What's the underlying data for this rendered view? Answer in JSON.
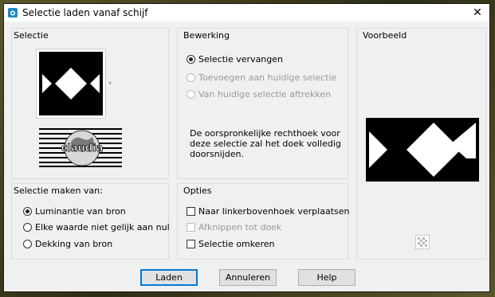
{
  "window": {
    "title": "Selectie laden vanaf schijf",
    "close_glyph": "✕"
  },
  "groups": {
    "selectie": {
      "label": "Selectie",
      "watermark_text": "claudia"
    },
    "bewerking": {
      "label": "Bewerking",
      "options": [
        {
          "label": "Selectie vervangen",
          "selected": true,
          "enabled": true
        },
        {
          "label": "Toevoegen aan huidige selectie",
          "selected": false,
          "enabled": false
        },
        {
          "label": "Van huidige selectie aftrekken",
          "selected": false,
          "enabled": false
        }
      ],
      "info": "De oorspronkelijke rechthoek voor deze selectie zal het doek volledig doorsnijden."
    },
    "voorbeeld": {
      "label": "Voorbeeld"
    },
    "selectie_maken": {
      "label": "Selectie maken van:",
      "options": [
        {
          "label": "Luminantie van bron",
          "selected": true
        },
        {
          "label": "Elke waarde niet gelijk aan nul",
          "selected": false
        },
        {
          "label": "Dekking van bron",
          "selected": false
        }
      ]
    },
    "opties": {
      "label": "Opties",
      "checks": [
        {
          "label": "Naar linkerbovenhoek verplaatsen",
          "checked": false,
          "enabled": true
        },
        {
          "label": "Afknippen tot doek",
          "checked": false,
          "enabled": false
        },
        {
          "label": "Selectie omkeren",
          "checked": false,
          "enabled": true
        }
      ]
    }
  },
  "buttons": {
    "load": "Laden",
    "cancel": "Annuleren",
    "help": "Help"
  },
  "colors": {
    "accent": "#0078d7",
    "icon": "#1e8bc3"
  }
}
